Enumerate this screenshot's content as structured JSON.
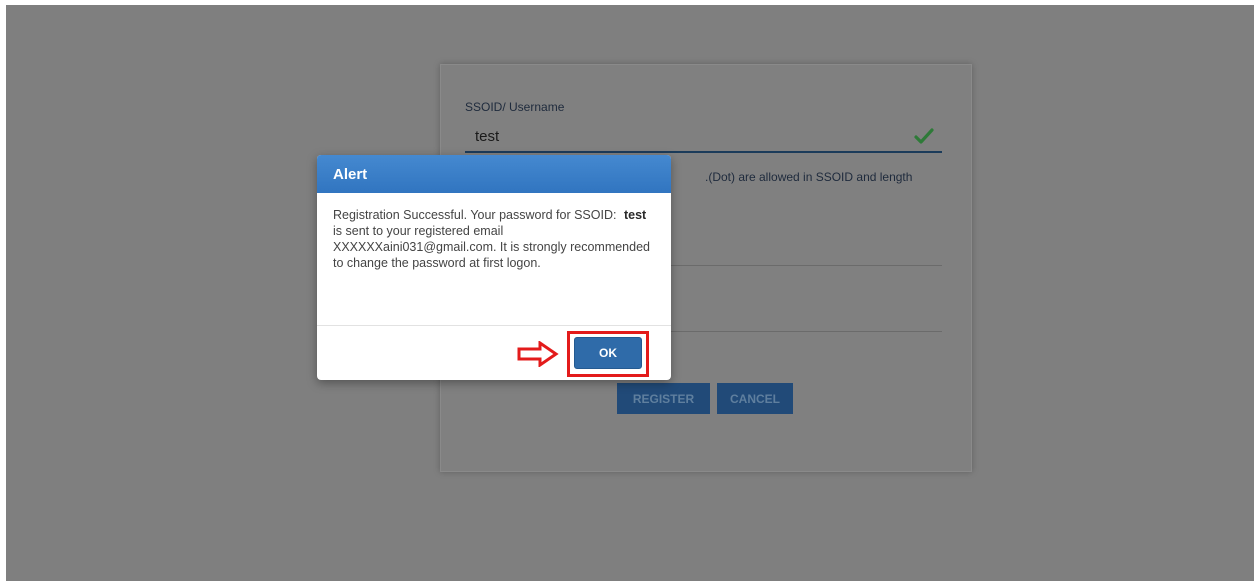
{
  "registration_form": {
    "ssoid_label": "SSOID/ Username",
    "ssoid_value": "test",
    "ssoid_hint": ".(Dot) are allowed in SSOID and length",
    "register_label": "REGISTER",
    "cancel_label": "CANCEL"
  },
  "alert": {
    "title": "Alert",
    "message_part1": "Registration Successful. Your password for SSOID:",
    "ssoid": "test",
    "message_part2": "is sent to your registered email XXXXXXaini031@gmail.com. It is strongly recommended to change the password at first logon.",
    "ok_label": "OK"
  },
  "colors": {
    "overlay": "#7f7f7f",
    "alert_header": "#3a7dc6",
    "ok_button": "#2f6ba9",
    "highlight": "#e31b1b",
    "check": "#2e9e3e"
  },
  "icons": {
    "valid": "check-icon",
    "pointer": "right-arrow-icon"
  }
}
